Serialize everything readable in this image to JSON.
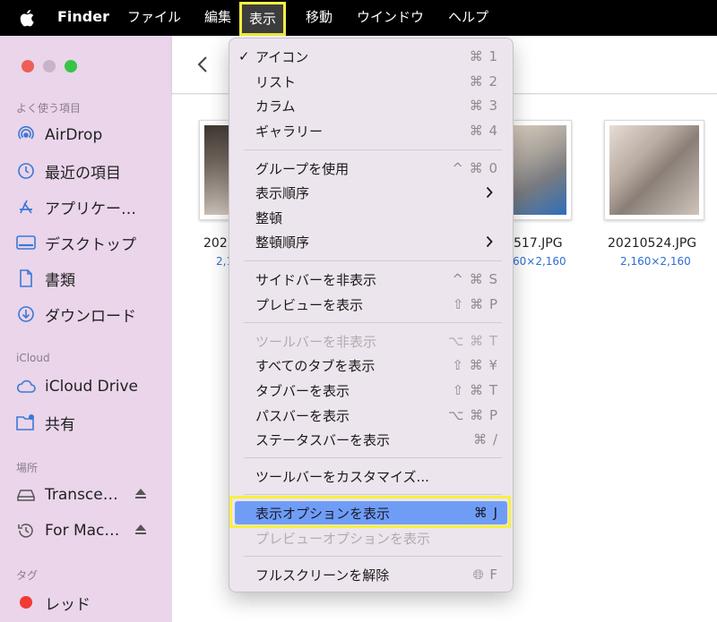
{
  "menubar": {
    "app_name": "Finder",
    "items": [
      "ファイル",
      "編集",
      "表示",
      "移動",
      "ウインドウ",
      "ヘルプ"
    ]
  },
  "sidebar": {
    "favorites_title": "よく使う項目",
    "favorites": [
      "AirDrop",
      "最近の項目",
      "アプリケー…",
      "デスクトップ",
      "書類",
      "ダウンロード"
    ],
    "icloud_title": "iCloud",
    "icloud": [
      "iCloud Drive",
      "共有"
    ],
    "locations_title": "場所",
    "locations": [
      "Transce…",
      "For Mac…"
    ],
    "tags_title": "タグ",
    "tags": [
      "レッド"
    ]
  },
  "files": [
    {
      "name": "202",
      "dims": "2,1"
    },
    {
      "name": "517.JPG",
      "dims": "60×2,160"
    },
    {
      "name": "20210524.JPG",
      "dims": "2,160×2,160"
    }
  ],
  "view_menu": {
    "items": [
      {
        "label": "アイコン",
        "shortcut": "⌘ 1",
        "checked": true
      },
      {
        "label": "リスト",
        "shortcut": "⌘ 2"
      },
      {
        "label": "カラム",
        "shortcut": "⌘ 3"
      },
      {
        "label": "ギャラリー",
        "shortcut": "⌘ 4"
      },
      {
        "label": "グループを使用",
        "shortcut": "^ ⌘ 0"
      },
      {
        "label": "表示順序",
        "submenu": true
      },
      {
        "label": "整頓"
      },
      {
        "label": "整頓順序",
        "submenu": true
      },
      {
        "label": "サイドバーを非表示",
        "shortcut": "^ ⌘ S"
      },
      {
        "label": "プレビューを表示",
        "shortcut": "⇧ ⌘ P"
      },
      {
        "label": "ツールバーを非表示",
        "shortcut": "⌥ ⌘ T",
        "disabled": true
      },
      {
        "label": "すべてのタブを表示",
        "shortcut": "⇧ ⌘ ¥"
      },
      {
        "label": "タブバーを表示",
        "shortcut": "⇧ ⌘ T"
      },
      {
        "label": "パスバーを表示",
        "shortcut": "⌥ ⌘ P"
      },
      {
        "label": "ステータスバーを表示",
        "shortcut": "⌘ /"
      },
      {
        "label": "ツールバーをカスタマイズ..."
      },
      {
        "label": "表示オプションを表示",
        "shortcut": "⌘ J",
        "highlighted": true
      },
      {
        "label": "プレビューオプションを表示",
        "disabled": true
      },
      {
        "label": "フルスクリーンを解除",
        "shortcut": "🌐︎ F"
      }
    ]
  },
  "colors": {
    "menubar": "#000000",
    "sidebar": "#ead5ea",
    "menu_bg": "#ece4ec",
    "highlight": "#6f9df6",
    "annotation_frame": "#f6f040"
  }
}
